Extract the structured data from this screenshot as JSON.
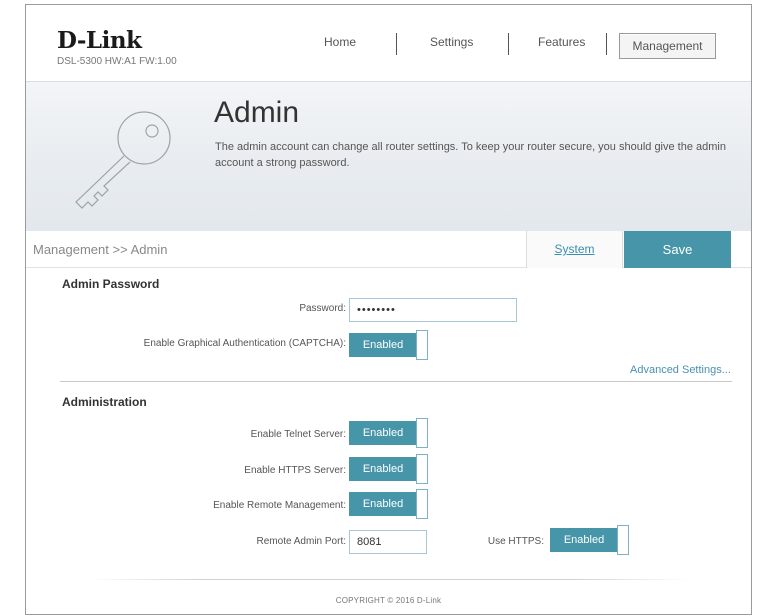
{
  "header": {
    "logo": "D-Link",
    "model_info": "DSL-5300 HW:A1 FW:1.00",
    "nav": [
      {
        "label": "Home"
      },
      {
        "label": "Settings"
      },
      {
        "label": "Features"
      },
      {
        "label": "Management"
      }
    ]
  },
  "banner": {
    "title": "Admin",
    "description": "The admin account can change all router settings. To keep your router secure, you should give the admin account a strong password.",
    "icon": "key-icon"
  },
  "breadcrumb": {
    "path": "Management >> Admin",
    "system_label": "System",
    "save_label": "Save"
  },
  "admin_password": {
    "title": "Admin Password",
    "password_label": "Password:",
    "password_value": "••••••••",
    "captcha_label": "Enable Graphical Authentication (CAPTCHA):",
    "captcha_value": "Enabled",
    "advanced_link": "Advanced Settings..."
  },
  "administration": {
    "title": "Administration",
    "telnet_label": "Enable Telnet Server:",
    "telnet_value": "Enabled",
    "https_label": "Enable HTTPS Server:",
    "https_value": "Enabled",
    "remote_label": "Enable Remote Management:",
    "remote_value": "Enabled",
    "port_label": "Remote Admin Port:",
    "port_value": "8081",
    "use_https_label": "Use HTTPS:",
    "use_https_value": "Enabled"
  },
  "footer": {
    "copyright": "COPYRIGHT © 2016 D-Link"
  },
  "colors": {
    "accent": "#4695a9",
    "link": "#4a90b0"
  }
}
